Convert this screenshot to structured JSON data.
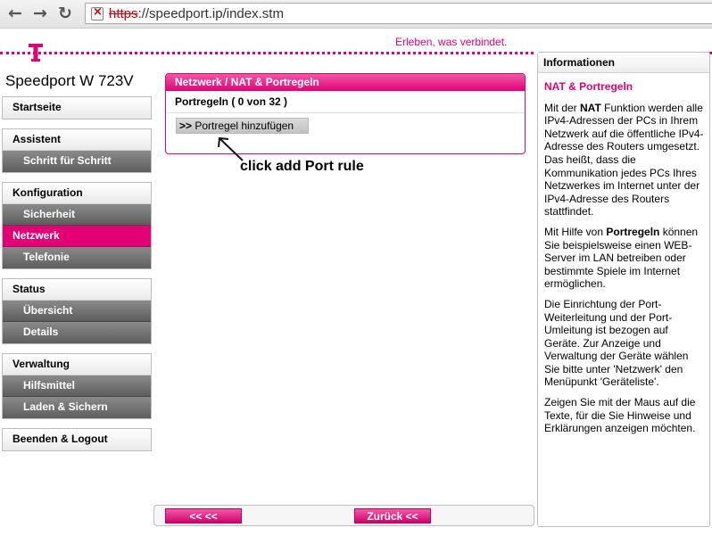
{
  "browser": {
    "url_scheme": "https",
    "url_rest": "://speedport.ip/index.stm"
  },
  "header": {
    "slogan": "Erleben, was verbindet.",
    "device_name": "Speedport W 723V",
    "brand_color": "#e20074"
  },
  "sidebar": {
    "groups": [
      {
        "items": [
          {
            "label": "Startseite",
            "level": "top"
          }
        ]
      },
      {
        "items": [
          {
            "label": "Assistent",
            "level": "top"
          },
          {
            "label": "Schritt für Schritt",
            "level": "sub"
          }
        ]
      },
      {
        "items": [
          {
            "label": "Konfiguration",
            "level": "top"
          },
          {
            "label": "Sicherheit",
            "level": "sub"
          },
          {
            "label": "Netzwerk",
            "level": "active"
          },
          {
            "label": "Telefonie",
            "level": "sub"
          }
        ]
      },
      {
        "items": [
          {
            "label": "Status",
            "level": "top"
          },
          {
            "label": "Übersicht",
            "level": "sub"
          },
          {
            "label": "Details",
            "level": "sub"
          }
        ]
      },
      {
        "items": [
          {
            "label": "Verwaltung",
            "level": "top"
          },
          {
            "label": "Hilfsmittel",
            "level": "sub"
          },
          {
            "label": "Laden & Sichern",
            "level": "sub"
          }
        ]
      },
      {
        "items": [
          {
            "label": "Beenden & Logout",
            "level": "top"
          }
        ]
      }
    ]
  },
  "main": {
    "panel_title": "Netzwerk / NAT & Portregeln",
    "rules_count": "Portregeln ( 0 von 32 )",
    "add_prefix": ">>",
    "add_label": "Portregel hinzufügen",
    "annotation": "click add Port rule"
  },
  "footer": {
    "back_left_label": "<<  <<",
    "back_right_label": "Zurück <<"
  },
  "info": {
    "header": "Informationen",
    "title": "NAT & Portregeln",
    "p1_a": "Mit der ",
    "p1_b": "NAT",
    "p1_c": " Funktion werden alle IPv4-Adressen der PCs in Ihrem Netzwerk auf die öffentliche IPv4-Adresse des Routers umgesetzt. Das heißt, dass die Kommunikation jedes PCs Ihres Netzwerkes im Internet unter der IPv4-Adresse des Routers stattfindet.",
    "p2_a": "Mit Hilfe von ",
    "p2_b": "Portregeln",
    "p2_c": " können Sie beispielsweise einen WEB-Server im LAN betreiben oder bestimmte Spiele im Internet ermöglichen.",
    "p3": "Die Einrichtung der Port-Weiterleitung und der Port-Umleitung ist bezogen auf Geräte. Zur Anzeige und Verwaltung der Geräte wählen Sie bitte unter 'Netzwerk' den Menüpunkt 'Geräteliste'.",
    "p4": "Zeigen Sie mit der Maus auf die Texte, für die Sie Hinweise und Erklärungen anzeigen möchten."
  }
}
